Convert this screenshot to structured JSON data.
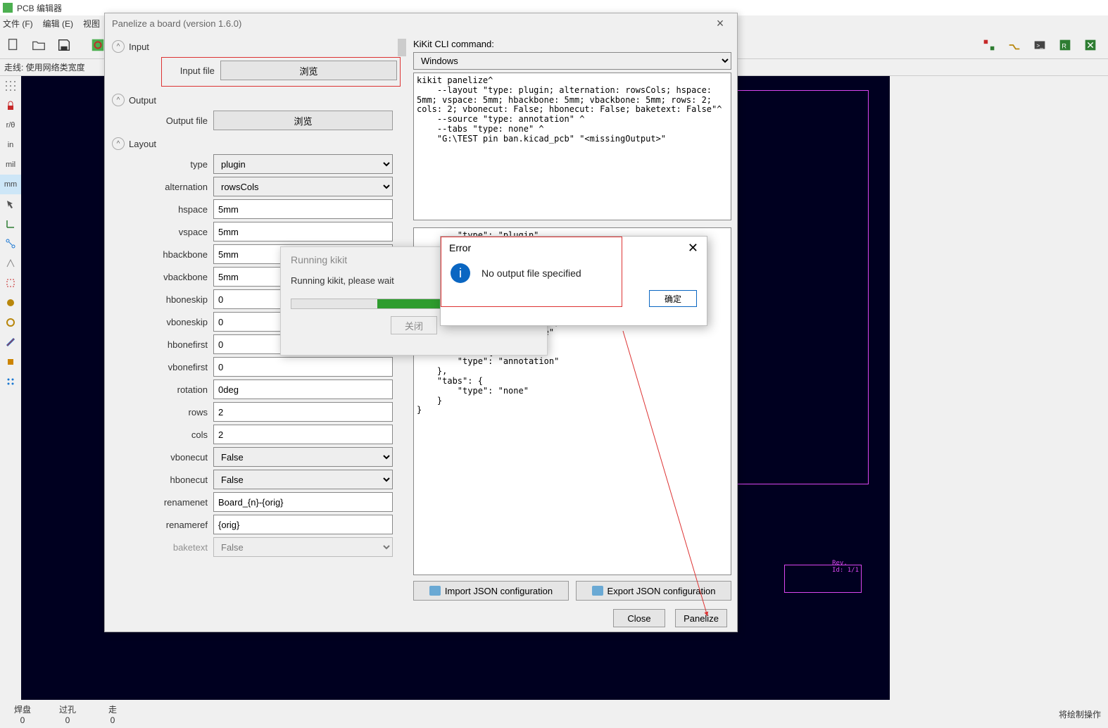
{
  "kicad": {
    "title": "PCB 编辑器",
    "menu": [
      "文件 (F)",
      "编辑 (E)",
      "视图"
    ],
    "track_label": "走线: 使用网络类宽度",
    "left_tools": [
      "",
      "",
      "",
      "r/θ",
      "in",
      "mil",
      "mm",
      "",
      "",
      "",
      "",
      "",
      "",
      "",
      "",
      "",
      "",
      "",
      ""
    ],
    "status_left": [
      {
        "t": "焊盘",
        "v": "0"
      },
      {
        "t": "过孔",
        "v": "0"
      },
      {
        "t": "走",
        "v": "0"
      }
    ],
    "status_right": "将绘制操作",
    "pcb_text": "Rev.\nId: 1/1"
  },
  "dialog": {
    "title": "Panelize a board  (version 1.6.0)",
    "sections": {
      "input": "Input",
      "output": "Output",
      "layout": "Layout"
    },
    "input_file_label": "Input file",
    "output_file_label": "Output file",
    "browse": "浏览",
    "layout_fields": {
      "type_label": "type",
      "type_val": "plugin",
      "alternation_label": "alternation",
      "alternation_val": "rowsCols",
      "hspace_label": "hspace",
      "hspace_val": "5mm",
      "vspace_label": "vspace",
      "vspace_val": "5mm",
      "hbackbone_label": "hbackbone",
      "hbackbone_val": "5mm",
      "vbackbone_label": "vbackbone",
      "vbackbone_val": "5mm",
      "hboneskip_label": "hboneskip",
      "hboneskip_val": "0",
      "vboneskip_label": "vboneskip",
      "vboneskip_val": "0",
      "hbonefirst_label": "hbonefirst",
      "hbonefirst_val": "0",
      "vbonefirst_label": "vbonefirst",
      "vbonefirst_val": "0",
      "rotation_label": "rotation",
      "rotation_val": "0deg",
      "rows_label": "rows",
      "rows_val": "2",
      "cols_label": "cols",
      "cols_val": "2",
      "vbonecut_label": "vbonecut",
      "vbonecut_val": "False",
      "hbonecut_label": "hbonecut",
      "hbonecut_val": "False",
      "renamenet_label": "renamenet",
      "renamenet_val": "Board_{n}-{orig}",
      "renameref_label": "renameref",
      "renameref_val": "{orig}",
      "baketext_label": "baketext",
      "baketext_val": "False"
    },
    "cli_label": "KiKit CLI command:",
    "cli_os": "Windows",
    "cli_text": "kikit panelize^\n    --layout \"type: plugin; alternation: rowsCols; hspace: 5mm; vspace: 5mm; hbackbone: 5mm; vbackbone: 5mm; rows: 2; cols: 2; vbonecut: False; hbonecut: False; baketext: False\"^\n    --source \"type: annotation\" ^\n    --tabs \"type: none\" ^\n    \"G:\\TEST pin ban.kicad_pcb\" \"<missingOutput>\"",
    "json_text": "        \"type\": \"plugin\",\n        \"alternation\": \"rowsCols\",\n        \"hspace\": \"5mm\",\n        \"vspace\": \"5mm\",\n        \"hbackbone\": \"5mm\",\n        \"vbackbone\": \"5mm\",\n        \"rows\": \"2\",\n        \"cols\": \"2\",\n        \"vbonecut\": \"False\",\n        \"hbonecut\": \"False\",\n        \"baketext\": \"False\"\n    },\n    \"source\": {\n        \"type\": \"annotation\"\n    },\n    \"tabs\": {\n        \"type\": \"none\"\n    }\n}",
    "import_btn": "Import JSON configuration",
    "export_btn": "Export JSON configuration",
    "close_btn": "Close",
    "panelize_btn": "Panelize"
  },
  "running": {
    "title": "Running kikit",
    "msg": "Running kikit, please wait",
    "close": "关闭"
  },
  "error": {
    "title": "Error",
    "msg": "No output file specified",
    "ok": "确定"
  }
}
